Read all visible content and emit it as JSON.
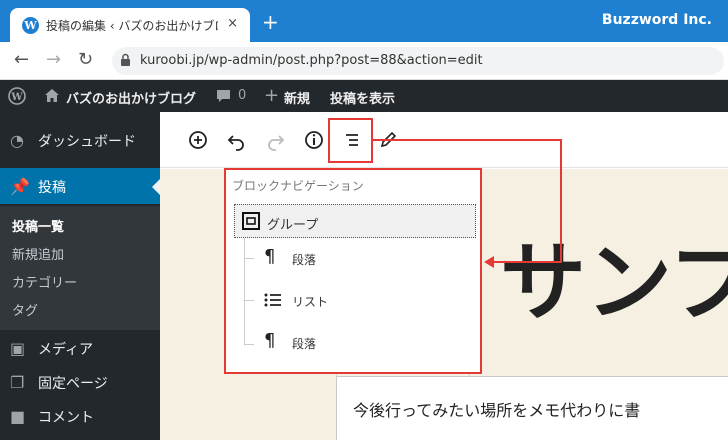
{
  "browser": {
    "tab_title": "投稿の編集 ‹ バズのお出かけブログ —",
    "tab_close": "×",
    "new_tab": "+",
    "brand": "Buzzword Inc.",
    "url": "kuroobi.jp/wp-admin/post.php?post=88&action=edit"
  },
  "adminbar": {
    "site_name": "バズのお出かけブログ",
    "comments_count": "0",
    "new_label": "新規",
    "view_post": "投稿を表示"
  },
  "sidebar": {
    "dashboard": "ダッシュボード",
    "posts": "投稿",
    "submenu": [
      "投稿一覧",
      "新規追加",
      "カテゴリー",
      "タグ"
    ],
    "media": "メディア",
    "pages": "固定ページ",
    "comments": "コメント"
  },
  "block_nav": {
    "title": "ブロックナビゲーション",
    "items": [
      {
        "label": "グループ",
        "icon": "group-block-icon"
      },
      {
        "label": "段落",
        "icon": "paragraph-icon"
      },
      {
        "label": "リスト",
        "icon": "list-icon"
      },
      {
        "label": "段落",
        "icon": "paragraph-icon"
      }
    ]
  },
  "editor": {
    "heading_text": "サンプ",
    "paragraph_text": "今後行ってみたい場所をメモ代わりに書"
  },
  "colors": {
    "admin_dark": "#23282d",
    "accent": "#0073aa",
    "annotation": "#e53935",
    "canvas_bg": "#f5f0e1"
  }
}
